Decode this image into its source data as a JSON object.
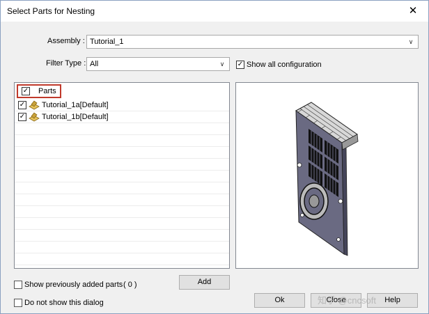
{
  "window": {
    "title": "Select Parts for Nesting",
    "close_glyph": "✕"
  },
  "assembly": {
    "label": "Assembly :",
    "value": "Tutorial_1"
  },
  "filter_type": {
    "label": "Filter Type :",
    "value": "All"
  },
  "show_all_configuration": {
    "label": "Show all configuration",
    "checked": true
  },
  "tree": {
    "root": {
      "label": "Parts",
      "checked": true
    },
    "items": [
      {
        "label": "Tutorial_1a[Default]",
        "checked": true,
        "icon": "part-icon"
      },
      {
        "label": "Tutorial_1b[Default]",
        "checked": true,
        "icon": "part-icon"
      }
    ]
  },
  "show_previously_added": {
    "label": "Show previously added parts",
    "count": "( 0 )",
    "checked": false
  },
  "do_not_show": {
    "label": "Do not show this dialog",
    "checked": false
  },
  "buttons": {
    "add": "Add",
    "ok": "Ok",
    "close": "Close",
    "help": "Help"
  },
  "watermark": "知乎 @cncsoft",
  "colors": {
    "highlight_box": "#c0392b",
    "part_icon": "#c9a23a",
    "preview_plate": "#6a6a82"
  }
}
